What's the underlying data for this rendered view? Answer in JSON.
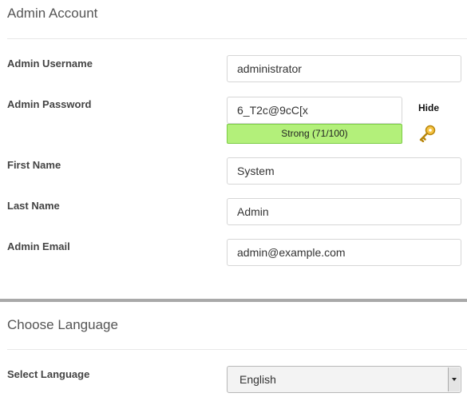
{
  "admin_account": {
    "title": "Admin Account",
    "username": {
      "label": "Admin Username",
      "value": "administrator"
    },
    "password": {
      "label": "Admin Password",
      "value": "6_T2c@9cC[x",
      "strength_text": "Strong (71/100)",
      "strength_score": 71,
      "strength_color": "#b3f07a",
      "hide_label": "Hide"
    },
    "first_name": {
      "label": "First Name",
      "value": "System"
    },
    "last_name": {
      "label": "Last Name",
      "value": "Admin"
    },
    "email": {
      "label": "Admin Email",
      "value": "admin@example.com"
    }
  },
  "language": {
    "title": "Choose Language",
    "select_label": "Select Language",
    "selected": "English"
  },
  "icons": {
    "password_generator": "key-icon"
  }
}
